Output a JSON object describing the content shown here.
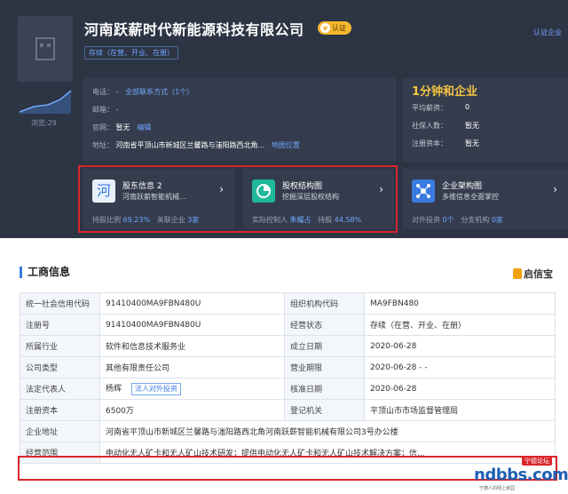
{
  "company": {
    "name": "河南跃薪时代新能源科技有限公司",
    "cert_label": "认证",
    "status": "存续（在营、开业、在册）",
    "verify_link": "认证企业",
    "views": "浏览:29"
  },
  "info": {
    "phone_label": "电话：",
    "phone_value": "-",
    "phone_link": "全部联系方式（1个）",
    "email_label": "邮箱：",
    "email_value": "-",
    "website_label": "官网：",
    "website_value": "暂无",
    "website_edit": "编辑",
    "address_label": "地址：",
    "address_value": "河南省平顶山市新城区兰馨路与滍阳路西北角...",
    "address_link": "地图位置"
  },
  "stats": {
    "title": "1分钟和企业",
    "salary_label": "平均薪资：",
    "salary_value": "0",
    "insured_label": "社保人数：",
    "insured_value": "暂无",
    "capital_label": "注册资本：",
    "capital_value": "暂无"
  },
  "cards": [
    {
      "title": "股东信息 2",
      "subtitle": "河南跃薪智能机械...",
      "icon": "company-char-icon",
      "icon_char": "河",
      "footer_a": "持股比例",
      "footer_a_val": "69.23%",
      "footer_b": "关联企业",
      "footer_b_val": "3家"
    },
    {
      "title": "股权结构图",
      "subtitle": "挖掘深层股权结构",
      "icon": "pie-chart-icon",
      "footer_a": "实际控制人",
      "footer_a_val": "朱耀占",
      "footer_b": "持股",
      "footer_b_val": "44.58%"
    },
    {
      "title": "企业架构图",
      "subtitle": "多维信息全面掌控",
      "icon": "org-chart-icon",
      "footer_a": "对外投资",
      "footer_a_val": "0个",
      "footer_b": "分支机构",
      "footer_b_val": "0家"
    }
  ],
  "section": {
    "title": "工商信息",
    "brand": "启信宝"
  },
  "table": {
    "r1": {
      "k1": "统一社会信用代码",
      "v1": "91410400MA9FBN480U",
      "k2": "组织机构代码",
      "v2": "MA9FBN480"
    },
    "r2": {
      "k1": "注册号",
      "v1": "91410400MA9FBN480U",
      "k2": "经营状态",
      "v2": "存续（在营、开业、在册）"
    },
    "r3": {
      "k1": "所属行业",
      "v1": "软件和信息技术服务业",
      "k2": "成立日期",
      "v2": "2020-06-28"
    },
    "r4": {
      "k1": "公司类型",
      "v1": "其他有限责任公司",
      "k2": "营业期限",
      "v2": "2020-06-28 - -"
    },
    "r5": {
      "k1": "法定代表人",
      "v1": "杨辉",
      "tag": "法人对外投资",
      "k2": "核准日期",
      "v2": "2020-06-28"
    },
    "r6": {
      "k1": "注册资本",
      "v1": "6500万",
      "k2": "登记机关",
      "v2": "平顶山市市场监督管理局"
    },
    "r7": {
      "k1": "企业地址",
      "v1": "河南省平顶山市新城区兰馨路与滍阳路西北角河南跃薪智能机械有限公司3号办公楼"
    },
    "r8": {
      "k1": "经营范围",
      "v1": "电动化无人矿卡和无人矿山技术研发；提供电动化无人矿卡和无人矿山技术解决方案；信..."
    }
  },
  "watermark": {
    "tag": "宁德论坛",
    "main": "ndbbs.com",
    "sub": "宁德人的网上家园"
  }
}
